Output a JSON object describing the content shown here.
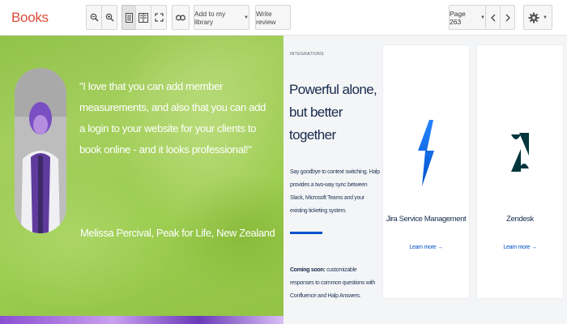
{
  "toolbar": {
    "brand": "Books",
    "add_to_library_label": "Add to my library",
    "write_review_label": "Write review",
    "page_label": "Page 263",
    "icons": [
      "zoom-out-icon",
      "zoom-in-icon",
      "single-page-icon",
      "two-page-icon",
      "fullscreen-icon",
      "link-icon",
      "chevron-left-icon",
      "chevron-right-icon",
      "gear-icon"
    ]
  },
  "testimonial": {
    "quote": "\"I love that you can add member measurements, and also that you can add a login to your website for your clients to book online - and it looks professional!\"",
    "author": "Melissa Percival, Peak for Life, New Zealand",
    "colors": {
      "background": "#9bcc4f",
      "text": "#ffffff"
    }
  },
  "integrations": {
    "eyebrow": "INTEGRATIONS",
    "headline": "Powerful alone, but better together",
    "body": "Say goodbye to context switching. Halp provides a two-way sync between Slack, Microsoft Teams and your existing ticketing system.",
    "coming_soon_label": "Coming soon:",
    "coming_soon_text": " customizable responses to common questions with Confluence and Halp Answers.",
    "cards": [
      {
        "title": "Jira Service Management",
        "link": "Learn more →",
        "logo": "jira-service-management-icon",
        "color": "#2684ff"
      },
      {
        "title": "Zendesk",
        "link": "Learn more →",
        "logo": "zendesk-icon",
        "color": "#03363d"
      }
    ],
    "colors": {
      "background": "#f4f5f7",
      "accent": "#0052cc",
      "heading": "#172b4d"
    }
  }
}
